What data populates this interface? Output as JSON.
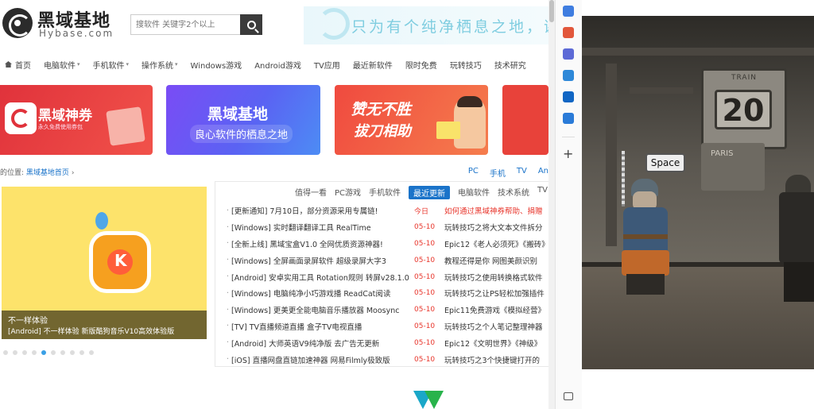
{
  "site": {
    "logo": {
      "title": "黑域基地",
      "subtitle": "Hybase.com"
    },
    "search": {
      "placeholder": "搜软件 关键字2个以上"
    },
    "banner": {
      "slogan": "只为有个纯净栖息之地，谢"
    },
    "nav": [
      {
        "label": "首页",
        "icon": "home-icon"
      },
      {
        "label": "电脑软件",
        "caret": "▾"
      },
      {
        "label": "手机软件",
        "caret": "▾"
      },
      {
        "label": "操作系统",
        "caret": "▾"
      },
      {
        "label": "Windows游戏"
      },
      {
        "label": "Android游戏"
      },
      {
        "label": "TV应用"
      },
      {
        "label": "最近新软件"
      },
      {
        "label": "限时免费"
      },
      {
        "label": "玩转技巧"
      },
      {
        "label": "技术研究"
      }
    ],
    "promos": {
      "p1": {
        "title": "黑域神券",
        "subtitle": "永久免费使用券包"
      },
      "p2": {
        "title": "黑域基地",
        "subtitle": "良心软件的栖息之地"
      },
      "p3": {
        "title": "赞无不胜",
        "subtitle": "拔刀相助"
      }
    },
    "breadcrumb": {
      "prefix": "的位置:",
      "link": "黑域基地首页",
      "sep": "›"
    },
    "crumb_tabs": [
      "PC",
      "手机",
      "TV",
      "An"
    ],
    "slider": {
      "caption_title": "不一样体验",
      "caption_text": "[Android] 不一样体验 新版酷狗音乐V10高效体验版",
      "dots": 10,
      "active_dot": 4
    },
    "updates": {
      "tabs": [
        "值得一看",
        "PC游戏",
        "手机软件",
        "最近更新",
        "电脑软件",
        "技术系统",
        "TV"
      ],
      "active_tab": "最近更新",
      "rows": [
        {
          "title": "[更新通知] 7月10日，部分资源采用专属链!",
          "date": "今日",
          "right": "如何通过黑域神券帮助、捐赠",
          "right_red": true
        },
        {
          "title": "[Windows] 实时翻译翻译工具 RealTime",
          "date": "05-10",
          "right": "玩转技巧之将大文本文件拆分",
          "right_red": false
        },
        {
          "title": "[全新上线] 黑域宝盒V1.0 全网优质资源神器!",
          "date": "05-10",
          "right": "Epic12《老人必须死》《搬砖》",
          "right_red": false
        },
        {
          "title": "[Windows] 全屏画面录屏软件 超级录屏大字3",
          "date": "05-10",
          "right": "教程还得是你 网图美颜识别",
          "right_red": false
        },
        {
          "title": "[Android] 安卓实用工具 Rotation规则 转屏v28.1.0",
          "date": "05-10",
          "right": "玩转技巧之使用转换格式软件",
          "right_red": false
        },
        {
          "title": "[Windows] 电脑纯净小巧游戏播 ReadCat阅读",
          "date": "05-10",
          "right": "玩转技巧之让PS轻松加强插件",
          "right_red": false
        },
        {
          "title": "[Windows] 更美更全能电脑音乐播放器 Moosync",
          "date": "05-10",
          "right": "Epic11免费游戏《模拟经营》",
          "right_red": false
        },
        {
          "title": "[TV] TV直播频道直播 盒子TV电视直播",
          "date": "05-10",
          "right": "玩转技巧之个人笔记整理神器",
          "right_red": false
        },
        {
          "title": "[Android] 大师英语V9纯净版 去广告无更新",
          "date": "05-10",
          "right": "Epic12《文明世界》《神级》",
          "right_red": false
        },
        {
          "title": "[iOS] 直播网盘直链加速神器 网易Filmly极致版",
          "date": "05-10",
          "right": "玩转技巧之3个快捷键打开的",
          "right_red": false
        }
      ]
    }
  },
  "browser_toolbar": {
    "icons": [
      "tag-icon",
      "toolbox-icon",
      "translate-icon",
      "shield-icon",
      "outlook-icon",
      "send-icon"
    ],
    "colors": [
      "#3f7de0",
      "#e2573b",
      "#5d6ad6",
      "#2e88d8",
      "#1166c4",
      "#2a7bd8"
    ],
    "add_label": "+"
  },
  "game": {
    "board_label": "TRAIN",
    "board_number": "20",
    "sign_text": "PARIS",
    "prompt_key": "Space"
  }
}
